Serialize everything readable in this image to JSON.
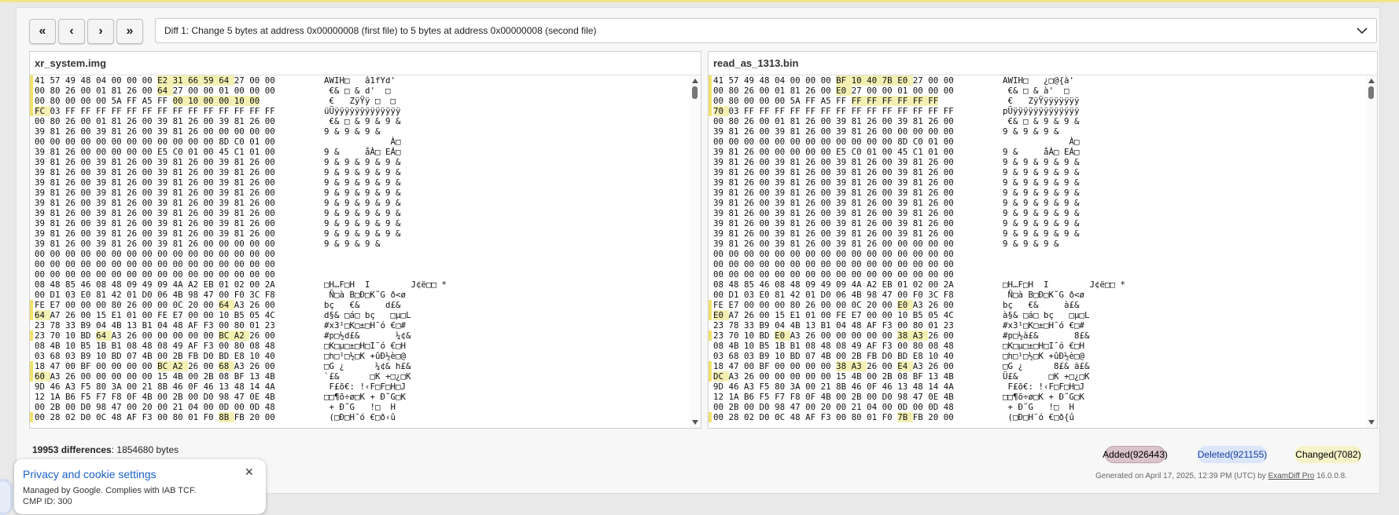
{
  "toolbar": {
    "first_label": "«",
    "prev_label": "‹",
    "next_label": "›",
    "last_label": "»",
    "diff_selection": "Diff 1: Change 5 bytes at address 0x00000008 (first file) to 5 bytes at address 0x00000008 (second file)"
  },
  "left_panel": {
    "file_name": "xr_system.img",
    "lines": [
      {
        "hex": "41 57 49 48 04 00 00 00 E2 31 66 59 64 27 00 00",
        "ascii": "AWIH□   â1fYd'"
      },
      {
        "hex": "00 80 26 00 01 81 26 00 64 27 00 00 01 00 00 00",
        "ascii": " €& □ & d'  □"
      },
      {
        "hex": "00 80 00 00 00 5A FF A5 FF 00 10 00 00 10 00",
        "ascii": " €   ZÿŸÿ □  □"
      },
      {
        "hex": "FC 03 FF FF FF FF FF FF FF FF FF FF FF FF FF FF",
        "ascii": "üŪÿÿÿÿÿÿÿÿÿÿÿÿÿ"
      },
      {
        "hex": "00 80 26 00 01 81 26 00 39 81 26 00 39 81 26 00",
        "ascii": " €& □ & 9 & 9 &"
      },
      {
        "hex": "39 81 26 00 39 81 26 00 39 81 26 00 00 00 00 00",
        "ascii": "9 & 9 & 9 &"
      },
      {
        "hex": "00 00 00 00 00 00 00 00 00 00 00 00 8D C0 01 00",
        "ascii": "             À□"
      },
      {
        "hex": "39 81 26 00 00 00 00 00 E5 C0 01 00 45 C1 01 00",
        "ascii": "9 &     åÀ□ EÁ□"
      },
      {
        "hex": "39 81 26 00 39 81 26 00 39 81 26 00 39 81 26 00",
        "ascii": "9 & 9 & 9 & 9 &"
      },
      {
        "hex": "39 81 26 00 39 81 26 00 39 81 26 00 39 81 26 00",
        "ascii": "9 & 9 & 9 & 9 &"
      },
      {
        "hex": "39 81 26 00 39 81 26 00 39 81 26 00 39 81 26 00",
        "ascii": "9 & 9 & 9 & 9 &"
      },
      {
        "hex": "39 81 26 00 39 81 26 00 39 81 26 00 39 81 26 00",
        "ascii": "9 & 9 & 9 & 9 &"
      },
      {
        "hex": "39 81 26 00 39 81 26 00 39 81 26 00 39 81 26 00",
        "ascii": "9 & 9 & 9 & 9 &"
      },
      {
        "hex": "39 81 26 00 39 81 26 00 39 81 26 00 39 81 26 00",
        "ascii": "9 & 9 & 9 & 9 &"
      },
      {
        "hex": "39 81 26 00 39 81 26 00 39 81 26 00 39 81 26 00",
        "ascii": "9 & 9 & 9 & 9 &"
      },
      {
        "hex": "39 81 26 00 39 81 26 00 39 81 26 00 39 81 26 00",
        "ascii": "9 & 9 & 9 & 9 &"
      },
      {
        "hex": "39 81 26 00 39 81 26 00 39 81 26 00 00 00 00 00",
        "ascii": "9 & 9 & 9 &"
      },
      {
        "hex": "00 00 00 00 00 00 00 00 00 00 00 00 00 00 00 00",
        "ascii": ""
      },
      {
        "hex": "00 00 00 00 00 00 00 00 00 00 00 00 00 00 00 00",
        "ascii": ""
      },
      {
        "hex": "00 00 00 00 00 00 00 00 00 00 00 00 00 00 00 00",
        "ascii": ""
      },
      {
        "hex": "08 48 85 46 08 48 09 49 09 4A A2 EB 01 02 00 2A",
        "ascii": "□H…F□H  I        J¢ë□□ *"
      },
      {
        "hex": "00 D1 03 E0 81 42 01 D0 06 4B 98 47 00 F0 3C F8",
        "ascii": " Ñ□à B□Đ□K˜G ð<ø"
      },
      {
        "hex": "FE E7 00 00 00 80 26 00 00 0C 20 00 64 A3 26 00",
        "ascii": "bç   €&     d£&"
      },
      {
        "hex": "64 A7 26 00 15 E1 01 00 FE E7 00 00 10 B5 05 4C",
        "ascii": "d§& □á□ bç   □µ□L"
      },
      {
        "hex": "23 78 33 B9 04 4B 13 B1 04 48 AF F3 00 80 01 23",
        "ascii": "#x3¹□K□±□H¯ó €□#"
      },
      {
        "hex": "23 70 10 BD 64 A3 26 00 00 00 00 00 BC A2 26 00",
        "ascii": "#p□½d£&       ¼¢&"
      },
      {
        "hex": "08 4B 10 B5 1B B1 08 48 08 49 AF F3 00 80 08 48",
        "ascii": "□K□µ□±□H□I¯ó €□H"
      },
      {
        "hex": "03 68 03 B9 10 BD 07 4B 00 2B FB D0 BD E8 10 40",
        "ascii": "□h□¹□½□K +ûÐ½è□@"
      },
      {
        "hex": "18 47 00 BF 00 00 00 00 BC A2 26 00 68 A3 26 00",
        "ascii": "□G ¿      ¼¢& h£&"
      },
      {
        "hex": "60 A3 26 00 00 00 00 00 15 4B 00 2B 08 BF 13 4B",
        "ascii": "`£&      □K +□¿□K"
      },
      {
        "hex": "9D 46 A3 F5 80 3A 00 21 8B 46 0F 46 13 48 14 4A",
        "ascii": " F£õ€: !‹F□F□H□J"
      },
      {
        "hex": "12 1A B6 F5 F7 F8 0F 4B 00 2B 00 D0 98 47 0E 4B",
        "ascii": "□□¶õ÷ø□K + Đ˜G□K"
      },
      {
        "hex": "00 2B 00 D0 98 47 00 20 00 21 04 00 0D 00 0D 48",
        "ascii": " + Đ˜G   !□  H"
      },
      {
        "hex": "00 28 02 D0 0C 48 AF F3 00 80 01 F0 8B FB 20 00",
        "ascii": " (□Đ□H¯ó €□ð‹û"
      }
    ]
  },
  "right_panel": {
    "file_name": "read_as_1313.bin",
    "lines": [
      {
        "hex": "41 57 49 48 04 00 00 00 BF 10 40 7B E0 27 00 00",
        "ascii": "AWIH□   ¿□@{à'"
      },
      {
        "hex": "00 80 26 00 01 81 26 00 E0 27 00 00 01 00 00 00",
        "ascii": " €& □ & à'  □"
      },
      {
        "hex": "00 80 00 00 00 5A FF A5 FF FF FF FF FF FF FF",
        "ascii": " €   ZÿŸÿÿÿÿÿÿÿ"
      },
      {
        "hex": "70 03 FF FF FF FF FF FF FF FF FF FF FF FF FF FF",
        "ascii": "pŪÿÿÿÿÿÿÿÿÿÿÿÿÿ"
      },
      {
        "hex": "00 80 26 00 01 81 26 00 39 81 26 00 39 81 26 00",
        "ascii": " €& □ & 9 & 9 &"
      },
      {
        "hex": "39 81 26 00 39 81 26 00 39 81 26 00 00 00 00 00",
        "ascii": "9 & 9 & 9 &"
      },
      {
        "hex": "00 00 00 00 00 00 00 00 00 00 00 00 8D C0 01 00",
        "ascii": "             À□"
      },
      {
        "hex": "39 81 26 00 00 00 00 00 E5 C0 01 00 45 C1 01 00",
        "ascii": "9 &     åÀ□ EÁ□"
      },
      {
        "hex": "39 81 26 00 39 81 26 00 39 81 26 00 39 81 26 00",
        "ascii": "9 & 9 & 9 & 9 &"
      },
      {
        "hex": "39 81 26 00 39 81 26 00 39 81 26 00 39 81 26 00",
        "ascii": "9 & 9 & 9 & 9 &"
      },
      {
        "hex": "39 81 26 00 39 81 26 00 39 81 26 00 39 81 26 00",
        "ascii": "9 & 9 & 9 & 9 &"
      },
      {
        "hex": "39 81 26 00 39 81 26 00 39 81 26 00 39 81 26 00",
        "ascii": "9 & 9 & 9 & 9 &"
      },
      {
        "hex": "39 81 26 00 39 81 26 00 39 81 26 00 39 81 26 00",
        "ascii": "9 & 9 & 9 & 9 &"
      },
      {
        "hex": "39 81 26 00 39 81 26 00 39 81 26 00 39 81 26 00",
        "ascii": "9 & 9 & 9 & 9 &"
      },
      {
        "hex": "39 81 26 00 39 81 26 00 39 81 26 00 39 81 26 00",
        "ascii": "9 & 9 & 9 & 9 &"
      },
      {
        "hex": "39 81 26 00 39 81 26 00 39 81 26 00 39 81 26 00",
        "ascii": "9 & 9 & 9 & 9 &"
      },
      {
        "hex": "39 81 26 00 39 81 26 00 39 81 26 00 00 00 00 00",
        "ascii": "9 & 9 & 9 &"
      },
      {
        "hex": "00 00 00 00 00 00 00 00 00 00 00 00 00 00 00 00",
        "ascii": ""
      },
      {
        "hex": "00 00 00 00 00 00 00 00 00 00 00 00 00 00 00 00",
        "ascii": ""
      },
      {
        "hex": "00 00 00 00 00 00 00 00 00 00 00 00 00 00 00 00",
        "ascii": ""
      },
      {
        "hex": "08 48 85 46 08 48 09 49 09 4A A2 EB 01 02 00 2A",
        "ascii": "□H…F□H  I        J¢ë□□ *"
      },
      {
        "hex": "00 D1 03 E0 81 42 01 D0 06 4B 98 47 00 F0 3C F8",
        "ascii": " Ñ□à B□Đ□K˜G ð<ø"
      },
      {
        "hex": "FE E7 00 00 00 80 26 00 00 0C 20 00 E0 A3 26 00",
        "ascii": "bç   €&     à£&"
      },
      {
        "hex": "E0 A7 26 00 15 E1 01 00 FE E7 00 00 10 B5 05 4C",
        "ascii": "à§& □á□ bç   □µ□L"
      },
      {
        "hex": "23 78 33 B9 04 4B 13 B1 04 48 AF F3 00 80 01 23",
        "ascii": "#x3¹□K□±□H¯ó €□#"
      },
      {
        "hex": "23 70 10 BD E0 A3 26 00 00 00 00 00 38 A3 26 00",
        "ascii": "#p□½à£&       8£&"
      },
      {
        "hex": "08 4B 10 B5 1B B1 08 48 08 49 AF F3 00 80 08 48",
        "ascii": "□K□µ□±□H□I¯ó €□H"
      },
      {
        "hex": "03 68 03 B9 10 BD 07 4B 00 2B FB D0 BD E8 10 40",
        "ascii": "□h□¹□½□K +ûÐ½è□@"
      },
      {
        "hex": "18 47 00 BF 00 00 00 00 38 A3 26 00 E4 A3 26 00",
        "ascii": "□G ¿      8£& ä£&"
      },
      {
        "hex": "DC A3 26 00 00 00 00 00 15 4B 00 2B 08 BF 13 4B",
        "ascii": "Ü£&      □K +□¿□K"
      },
      {
        "hex": "9D 46 A3 F5 80 3A 00 21 8B 46 0F 46 13 48 14 4A",
        "ascii": " F£õ€: !‹F□F□H□J"
      },
      {
        "hex": "12 1A B6 F5 F7 F8 0F 4B 00 2B 00 D0 98 47 0E 4B",
        "ascii": "□□¶õ÷ø□K + Đ˜G□K"
      },
      {
        "hex": "00 2B 00 D0 98 47 00 20 00 21 04 00 0D 00 0D 48",
        "ascii": " + Đ˜G   !□  H"
      },
      {
        "hex": "00 28 02 D0 0C 48 AF F3 00 80 01 F0 7B FB 20 00",
        "ascii": " (□Đ□H¯ó €□ð{û"
      }
    ]
  },
  "summary": {
    "count_bold": "19953 differences",
    "rest": ": 1854680 bytes"
  },
  "legend": {
    "added": "Added(926443)",
    "deleted": "Deleted(921155)",
    "changed": "Changed(7082)",
    "added_color": "#d9c3cc",
    "deleted_color": "#dbe6fb",
    "changed_color": "#f6f3c9"
  },
  "footer": {
    "generated_prefix": "Generated on April 17, 2025, 12:39 PM (UTC) by ",
    "product_link": "ExamDiff Pro",
    "version": " 16.0.0.8."
  },
  "cookie": {
    "title": "Privacy and cookie settings",
    "line1": "Managed by Google. Complies with IAB TCF.",
    "line2": "CMP ID: 300",
    "close": "×"
  },
  "colors": {
    "change_highlight": "#f4f0b4",
    "gutter_highlight": "#f0e26a"
  }
}
